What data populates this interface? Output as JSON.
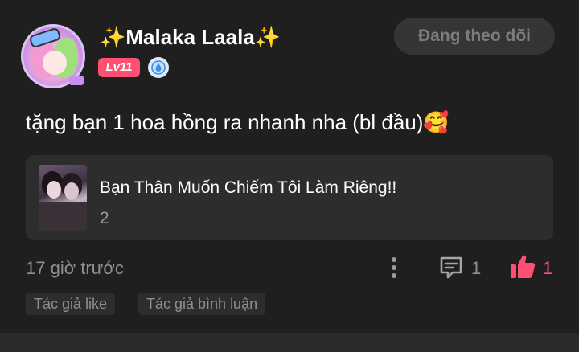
{
  "user": {
    "name": "Malaka Laala",
    "sparkle_left": "✨",
    "sparkle_right": "✨",
    "level": "Lv11"
  },
  "follow_button": {
    "label": "Đang theo dõi"
  },
  "comment": {
    "text": "tặng bạn 1 hoa hồng ra nhanh nha (bl đầu)🥰"
  },
  "story": {
    "title": "Bạn Thân Muốn Chiếm Tôi Làm Riêng!!",
    "count": "2"
  },
  "meta": {
    "timestamp": "17 giờ trước",
    "comment_count": "1",
    "like_count": "1"
  },
  "tags": {
    "author_like": "Tác giả like",
    "author_comment": "Tác giả bình luận"
  },
  "colors": {
    "background": "#1f1f1f",
    "accent_pink": "#ff4f72",
    "muted_text": "#8f8f8f",
    "card_bg": "#2d2d2d"
  },
  "icons": {
    "more": "more-vertical-icon",
    "comment": "comment-icon",
    "like": "thumbs-up-icon",
    "verify": "verified-badge-icon"
  }
}
